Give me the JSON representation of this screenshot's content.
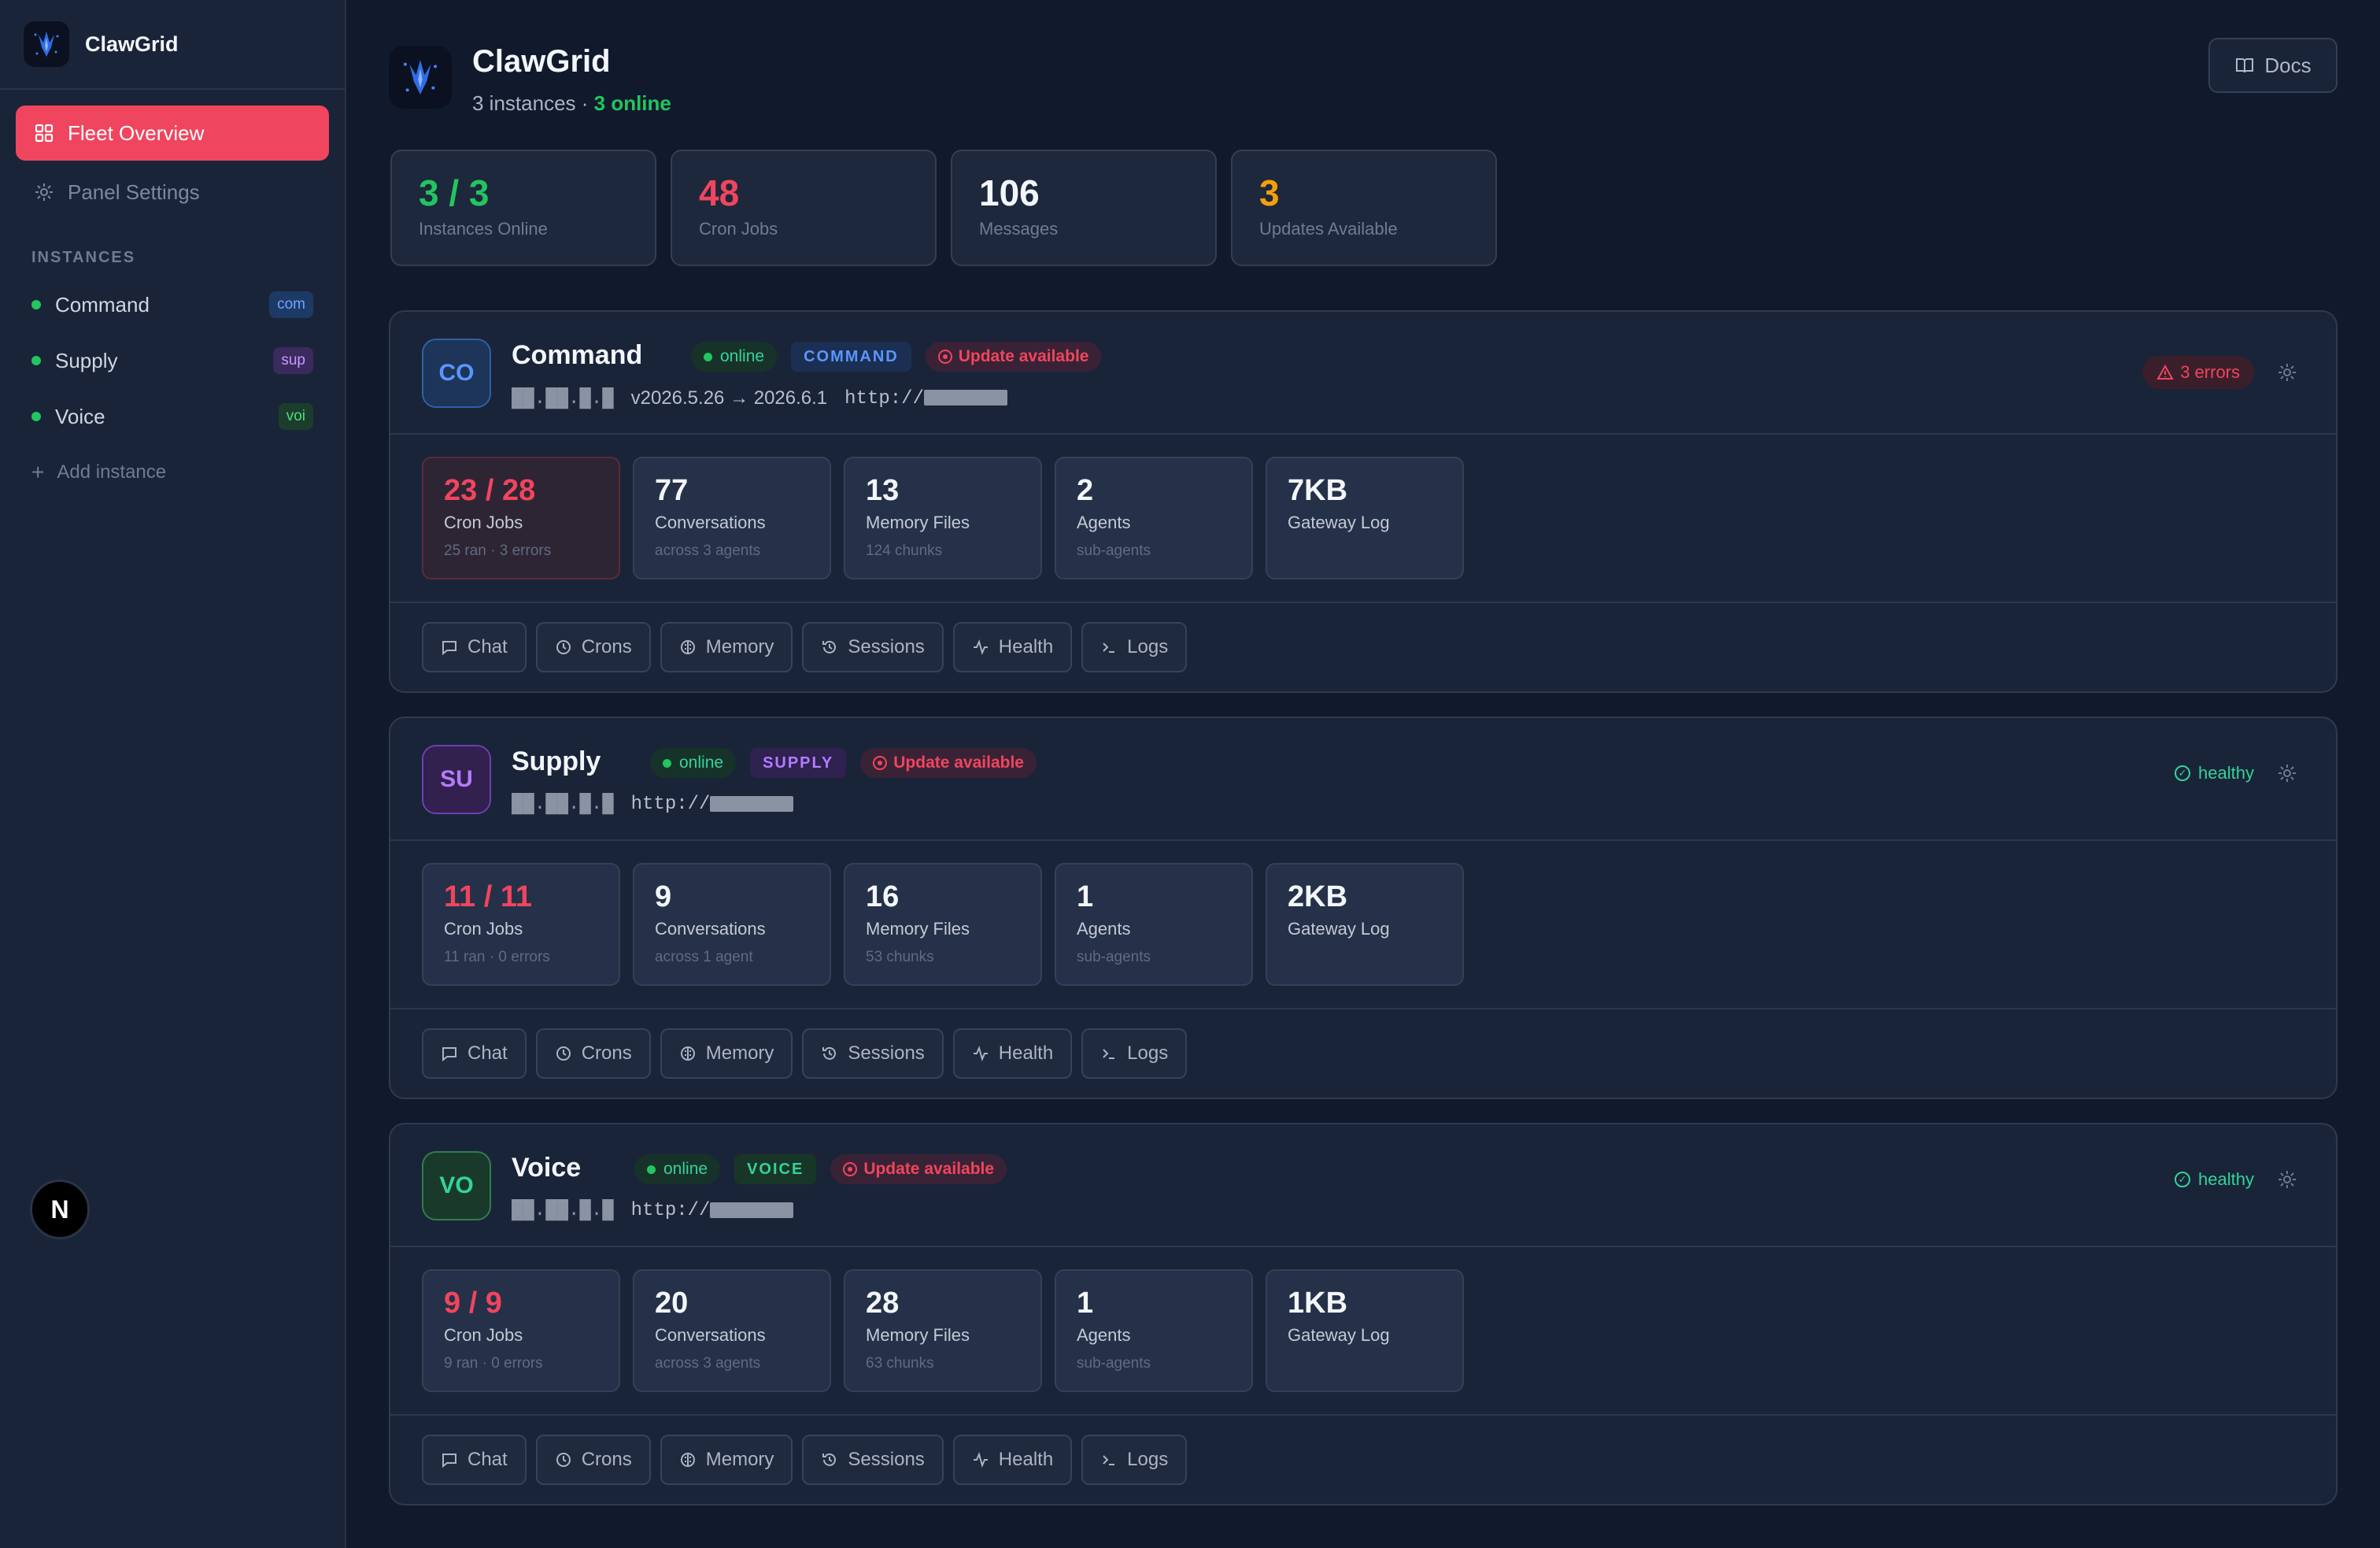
{
  "app": {
    "name": "ClawGrid"
  },
  "sidebar": {
    "title": "ClawGrid",
    "nav": [
      {
        "label": "Fleet Overview",
        "icon": "grid-icon",
        "active": true
      },
      {
        "label": "Panel Settings",
        "icon": "gear-icon",
        "active": false
      }
    ],
    "section_label": "INSTANCES",
    "instances": [
      {
        "label": "Command",
        "tag": "com",
        "status_color": "#22c55e"
      },
      {
        "label": "Supply",
        "tag": "sup",
        "status_color": "#22c55e"
      },
      {
        "label": "Voice",
        "tag": "voi",
        "status_color": "#22c55e"
      }
    ],
    "add_label": "Add instance",
    "user_avatar": "N"
  },
  "header": {
    "title": "ClawGrid",
    "subtitle_prefix": "3 instances · ",
    "subtitle_online": "3 online",
    "docs_label": "Docs"
  },
  "stats": [
    {
      "value": "3 / 3",
      "label": "Instances Online",
      "color": "#22c55e"
    },
    {
      "value": "48",
      "label": "Cron Jobs",
      "color": "#f0455e"
    },
    {
      "value": "106",
      "label": "Messages",
      "color": "#f3f6fb"
    },
    {
      "value": "3",
      "label": "Updates Available",
      "color": "#f59e0b"
    }
  ],
  "instances": [
    {
      "badge": "CO",
      "name": "Command",
      "online_label": "online",
      "role": "COMMAND",
      "update_label": "Update available",
      "ip_masked": "██.██.█.█",
      "version": "v2026.5.26 → 2026.6.1",
      "url": "http://",
      "status": "3 errors",
      "status_type": "error",
      "metrics": [
        {
          "value": "23 / 28",
          "label": "Cron Jobs",
          "sub": "25 ran · 3 errors",
          "alert": true
        },
        {
          "value": "77",
          "label": "Conversations",
          "sub": "across 3 agents"
        },
        {
          "value": "13",
          "label": "Memory Files",
          "sub": "124 chunks"
        },
        {
          "value": "2",
          "label": "Agents",
          "sub": "sub-agents"
        },
        {
          "value": "7KB",
          "label": "Gateway Log",
          "sub": ""
        }
      ]
    },
    {
      "badge": "SU",
      "name": "Supply",
      "online_label": "online",
      "role": "SUPPLY",
      "update_label": "Update available",
      "ip_masked": "██.██.█.█",
      "version": "",
      "url": "http://",
      "status": "healthy",
      "status_type": "healthy",
      "metrics": [
        {
          "value": "11 / 11",
          "label": "Cron Jobs",
          "sub": "11 ran · 0 errors",
          "alert": false
        },
        {
          "value": "9",
          "label": "Conversations",
          "sub": "across 1 agent"
        },
        {
          "value": "16",
          "label": "Memory Files",
          "sub": "53 chunks"
        },
        {
          "value": "1",
          "label": "Agents",
          "sub": "sub-agents"
        },
        {
          "value": "2KB",
          "label": "Gateway Log",
          "sub": ""
        }
      ]
    },
    {
      "badge": "VO",
      "name": "Voice",
      "online_label": "online",
      "role": "VOICE",
      "update_label": "Update available",
      "ip_masked": "██.██.█.█",
      "version": "",
      "url": "http://",
      "status": "healthy",
      "status_type": "healthy",
      "metrics": [
        {
          "value": "9 / 9",
          "label": "Cron Jobs",
          "sub": "9 ran · 0 errors",
          "alert": false
        },
        {
          "value": "20",
          "label": "Conversations",
          "sub": "across 3 agents"
        },
        {
          "value": "28",
          "label": "Memory Files",
          "sub": "63 chunks"
        },
        {
          "value": "1",
          "label": "Agents",
          "sub": "sub-agents"
        },
        {
          "value": "1KB",
          "label": "Gateway Log",
          "sub": ""
        }
      ]
    }
  ],
  "actions": [
    {
      "label": "Chat",
      "icon": "chat-icon"
    },
    {
      "label": "Crons",
      "icon": "clock-icon"
    },
    {
      "label": "Memory",
      "icon": "brain-icon"
    },
    {
      "label": "Sessions",
      "icon": "history-icon"
    },
    {
      "label": "Health",
      "icon": "pulse-icon"
    },
    {
      "label": "Logs",
      "icon": "terminal-icon"
    }
  ],
  "colors": {
    "accent": "#f0455e",
    "online": "#22c55e",
    "command_role": "#3b82f6",
    "supply_role": "#a855f7",
    "voice_role": "#22c55e"
  }
}
